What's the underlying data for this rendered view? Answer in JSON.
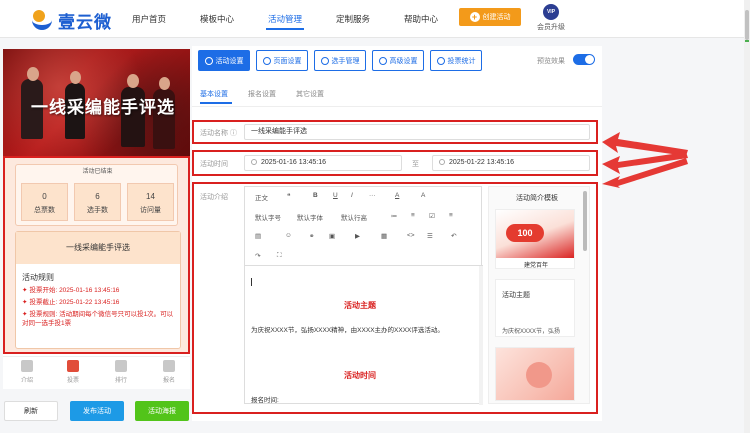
{
  "brand": {
    "name": "壹云微"
  },
  "nav": [
    {
      "label": "用户首页"
    },
    {
      "label": "模板中心"
    },
    {
      "label": "活动管理"
    },
    {
      "label": "定制服务"
    },
    {
      "label": "帮助中心"
    }
  ],
  "header": {
    "create_label": "创建活动",
    "vip_badge": "VIP",
    "vip_label": "会员升级"
  },
  "preview": {
    "banner_title": "一线采编能手评选",
    "stat_head": "活动已结束",
    "stats": [
      {
        "value": "0",
        "label": "总票数"
      },
      {
        "value": "6",
        "label": "选手数"
      },
      {
        "value": "14",
        "label": "访问量"
      }
    ],
    "rule_title": "一线采编能手评选",
    "rules_heading": "活动规则",
    "rules": [
      "投票开始: 2025-01-16 13:45:16",
      "投票截止: 2025-01-22 13:45:16",
      "投票规则: 活动期间每个微信号只可以投1次。可以对同一选手投1票"
    ],
    "tabs": [
      "介绍",
      "投票",
      "排行",
      "报名"
    ]
  },
  "bottom_actions": {
    "refresh": "刷新",
    "publish": "发布活动",
    "poster": "活动海报"
  },
  "toolbar": [
    {
      "label": "活动设置",
      "icon": "plus-icon"
    },
    {
      "label": "页面设置",
      "icon": "gear-icon"
    },
    {
      "label": "选手管理",
      "icon": "users-icon"
    },
    {
      "label": "高级设置",
      "icon": "sliders-icon"
    },
    {
      "label": "投票统计",
      "icon": "chart-icon"
    }
  ],
  "preview_toggle": {
    "label": "预览效果",
    "on": true
  },
  "subtabs": [
    "基本设置",
    "报名设置",
    "其它设置"
  ],
  "form": {
    "name_label": "活动名称",
    "name_value": "一线采编能手评选",
    "time_label": "活动时间",
    "start_time": "2025-01-16 13:45:16",
    "time_sep": "至",
    "end_time": "2025-01-22 13:45:16",
    "intro_label": "活动介绍"
  },
  "editor": {
    "row1": [
      "正文",
      "❝",
      "B",
      "U",
      "I",
      "···",
      "A",
      "A"
    ],
    "row2": [
      "默认字号",
      "默认字体",
      "默认行高",
      "≔",
      "≡",
      "☑",
      "≡"
    ],
    "row3": [
      "▤",
      "☺",
      "⚭",
      "▣",
      "▶",
      "▦",
      "<>",
      "☰",
      "↶"
    ],
    "row4": [
      "↷",
      "⛶"
    ],
    "content": {
      "theme_heading": "活动主题",
      "theme_text": "为庆祝XXXX节，弘扬XXXX精神，由XXXX主办的XXXX评选活动。",
      "time_heading": "活动时间",
      "time_text": "报名时间:"
    }
  },
  "template_panel": {
    "title": "活动简介模板",
    "card1_caption": "建党百年",
    "card2_title": "活动主题",
    "card2_text": "为庆祝XXXX节，弘扬"
  },
  "colors": {
    "primary": "#1d6de6",
    "accent": "#f39a1a",
    "highlight": "#d9201f",
    "success": "#52c41a"
  }
}
